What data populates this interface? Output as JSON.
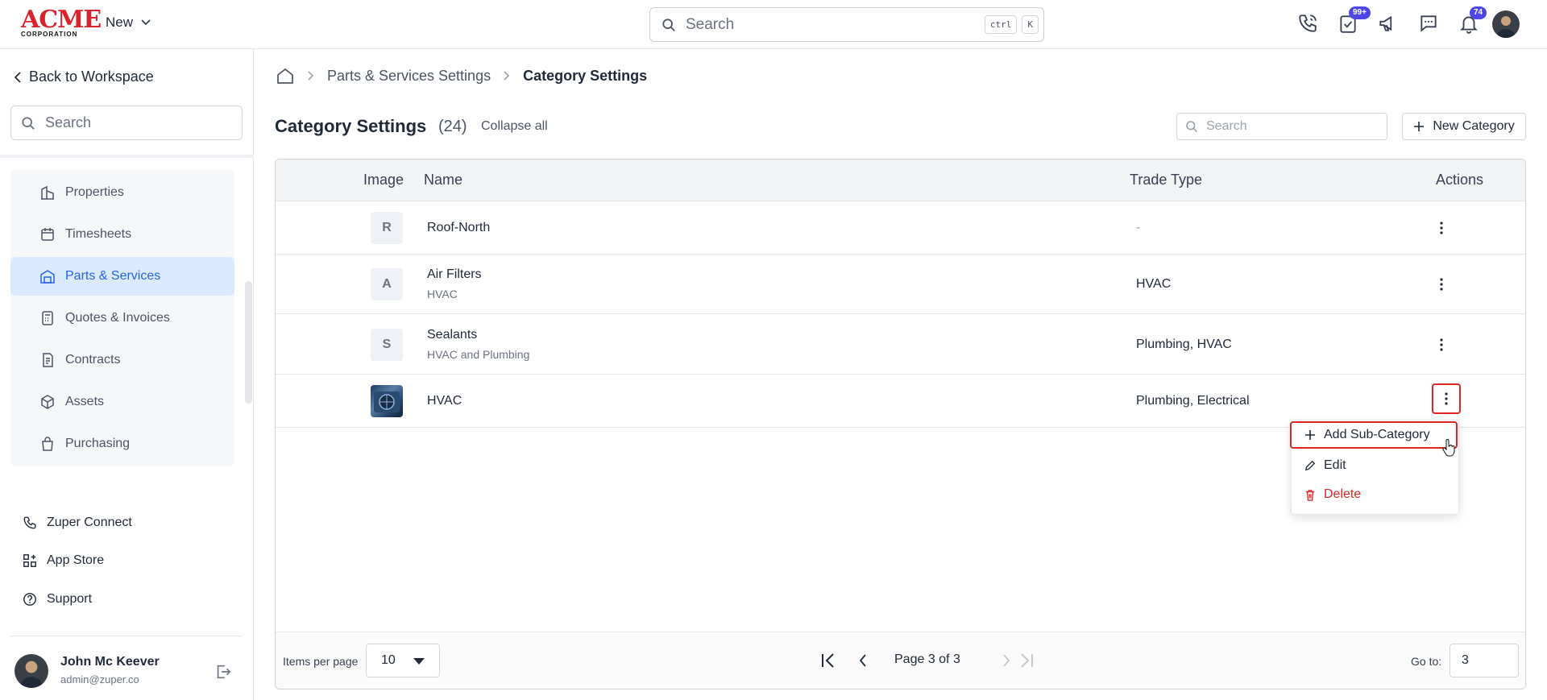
{
  "topbar": {
    "logo_text": "ACME",
    "logo_sub": "CORPORATION",
    "new_label": "New",
    "search_placeholder": "Search",
    "kbd_ctrl": "ctrl",
    "kbd_k": "K",
    "badges": {
      "tasks": "99+",
      "notifications": "74"
    },
    "icons": [
      "phone-icon",
      "tasks-icon",
      "megaphone-icon",
      "chat-icon",
      "bell-icon"
    ]
  },
  "sidebar": {
    "back_label": "Back to Workspace",
    "search_placeholder": "Search",
    "items": [
      {
        "label": "Properties",
        "icon": "building-icon"
      },
      {
        "label": "Timesheets",
        "icon": "calendar-icon"
      },
      {
        "label": "Parts & Services",
        "icon": "warehouse-icon",
        "active": true
      },
      {
        "label": "Quotes & Invoices",
        "icon": "calculator-icon"
      },
      {
        "label": "Contracts",
        "icon": "contract-icon"
      },
      {
        "label": "Assets",
        "icon": "box-icon"
      },
      {
        "label": "Purchasing",
        "icon": "bag-icon"
      }
    ],
    "bottom_links": [
      {
        "label": "Zuper Connect",
        "icon": "phone-icon"
      },
      {
        "label": "App Store",
        "icon": "apps-icon"
      },
      {
        "label": "Support",
        "icon": "help-icon"
      }
    ],
    "user": {
      "name": "John Mc Keever",
      "email": "admin@zuper.co"
    }
  },
  "breadcrumb": {
    "items": [
      "Parts & Services Settings",
      "Category Settings"
    ]
  },
  "page": {
    "title": "Category Settings",
    "count": "(24)",
    "collapse_label": "Collapse all",
    "search_placeholder": "Search",
    "new_button": "New Category"
  },
  "table": {
    "columns": {
      "image": "Image",
      "name": "Name",
      "trade": "Trade Type",
      "actions": "Actions"
    },
    "rows": [
      {
        "initial": "R",
        "name": "Roof-North",
        "desc": "",
        "trade": "-"
      },
      {
        "initial": "A",
        "name": "Air Filters",
        "desc": "HVAC",
        "trade": "HVAC"
      },
      {
        "initial": "S",
        "name": "Sealants",
        "desc": "HVAC and Plumbing",
        "trade": "Plumbing, HVAC"
      },
      {
        "initial": "",
        "name": "HVAC",
        "desc": "",
        "trade": "Plumbing, Electrical"
      }
    ]
  },
  "menu": {
    "add_sub": "Add Sub-Category",
    "edit": "Edit",
    "delete": "Delete"
  },
  "pagination": {
    "items_per_page_label": "Items per page",
    "items_per_page": "10",
    "page_text": "Page 3 of 3",
    "goto_label": "Go to:",
    "goto_value": "3"
  },
  "colors": {
    "accent": "#2563eb",
    "active_bg": "#dbeafe",
    "danger": "#dc2626",
    "badge": "#4f46e5",
    "brand": "#d9232d"
  }
}
